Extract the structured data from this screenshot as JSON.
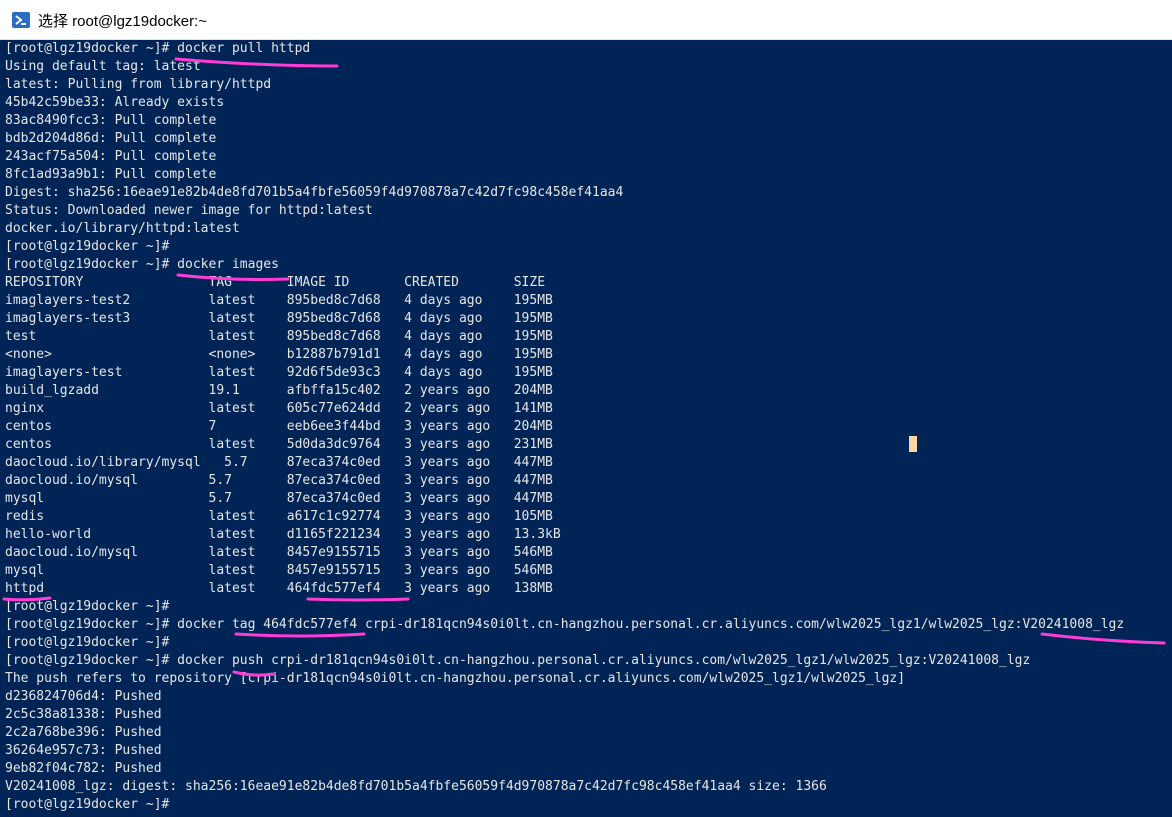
{
  "window": {
    "title": "选择 root@lgz19docker:~"
  },
  "terminal": {
    "lines": [
      "[root@lgz19docker ~]# docker pull httpd",
      "Using default tag: latest",
      "latest: Pulling from library/httpd",
      "45b42c59be33: Already exists",
      "83ac8490fcc3: Pull complete",
      "bdb2d204d86d: Pull complete",
      "243acf75a504: Pull complete",
      "8fc1ad93a9b1: Pull complete",
      "Digest: sha256:16eae91e82b4de8fd701b5a4fbfe56059f4d970878a7c42d7fc98c458ef41aa4",
      "Status: Downloaded newer image for httpd:latest",
      "docker.io/library/httpd:latest",
      "[root@lgz19docker ~]#",
      "[root@lgz19docker ~]# docker images",
      "REPOSITORY                TAG       IMAGE ID       CREATED       SIZE",
      "imaglayers-test2          latest    895bed8c7d68   4 days ago    195MB",
      "imaglayers-test3          latest    895bed8c7d68   4 days ago    195MB",
      "test                      latest    895bed8c7d68   4 days ago    195MB",
      "<none>                    <none>    b12887b791d1   4 days ago    195MB",
      "imaglayers-test           latest    92d6f5de93c3   4 days ago    195MB",
      "build_lgzadd              19.1      afbffa15c402   2 years ago   204MB",
      "nginx                     latest    605c77e624dd   2 years ago   141MB",
      "centos                    7         eeb6ee3f44bd   3 years ago   204MB",
      "centos                    latest    5d0da3dc9764   3 years ago   231MB",
      "daocloud.io/library/mysql   5.7     87eca374c0ed   3 years ago   447MB",
      "daocloud.io/mysql         5.7       87eca374c0ed   3 years ago   447MB",
      "mysql                     5.7       87eca374c0ed   3 years ago   447MB",
      "redis                     latest    a617c1c92774   3 years ago   105MB",
      "hello-world               latest    d1165f221234   3 years ago   13.3kB",
      "daocloud.io/mysql         latest    8457e9155715   3 years ago   546MB",
      "mysql                     latest    8457e9155715   3 years ago   546MB",
      "httpd                     latest    464fdc577ef4   3 years ago   138MB",
      "[root@lgz19docker ~]#",
      "[root@lgz19docker ~]# docker tag 464fdc577ef4 crpi-dr181qcn94s0i0lt.cn-hangzhou.personal.cr.aliyuncs.com/wlw2025_lgz1/wlw2025_lgz:V20241008_lgz",
      "[root@lgz19docker ~]#",
      "[root@lgz19docker ~]# docker push crpi-dr181qcn94s0i0lt.cn-hangzhou.personal.cr.aliyuncs.com/wlw2025_lgz1/wlw2025_lgz:V20241008_lgz",
      "The push refers to repository [crpi-dr181qcn94s0i0lt.cn-hangzhou.personal.cr.aliyuncs.com/wlw2025_lgz1/wlw2025_lgz]",
      "d236824706d4: Pushed",
      "2c5c38a81338: Pushed",
      "2c2a768be396: Pushed",
      "36264e957c73: Pushed",
      "9eb82f04c782: Pushed",
      "V20241008_lgz: digest: sha256:16eae91e82b4de8fd701b5a4fbfe56059f4d970878a7c42d7fc98c458ef41aa4 size: 1366",
      "[root@lgz19docker ~]#"
    ]
  },
  "colors": {
    "terminal_bg": "#012456",
    "terminal_fg": "#e6e6e6",
    "annotation": "#ff3bd8",
    "cursor": "#f7d9a8"
  },
  "icons": {
    "title": "powershell-icon"
  }
}
